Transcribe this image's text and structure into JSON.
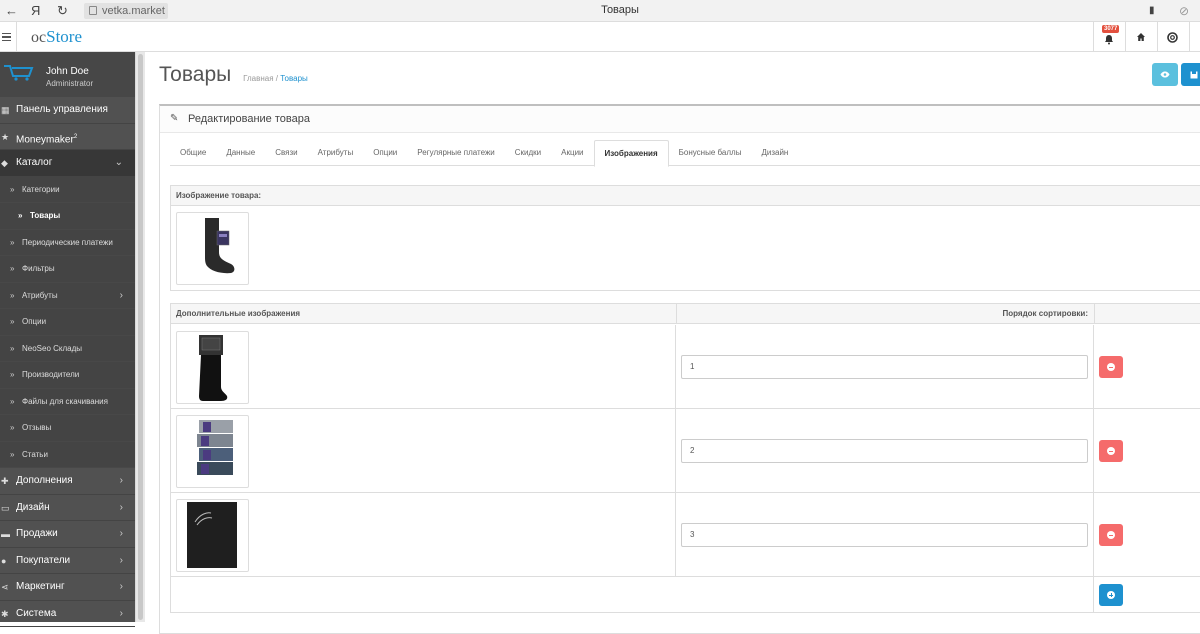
{
  "browser": {
    "address": "vetka.market",
    "title": "Товары",
    "yandex_glyph": "Я"
  },
  "header": {
    "logo_oc": "oc",
    "logo_store": "Store",
    "notification_count": "3077",
    "icons": [
      "bell-icon",
      "home-icon",
      "support-icon"
    ]
  },
  "sidebar": {
    "user_name": "John Doe",
    "user_role": "Administrator",
    "items": [
      {
        "label": "Панель управления",
        "icon": "dashboard-icon"
      },
      {
        "label": "Moneymaker",
        "sup": "2",
        "icon": "star-icon"
      },
      {
        "label": "Каталог",
        "icon": "tag-icon",
        "expanded": true
      }
    ],
    "catalog_sub": [
      {
        "label": "Категории"
      },
      {
        "label": "Товары",
        "current": true
      },
      {
        "label": "Периодические платежи"
      },
      {
        "label": "Фильтры"
      },
      {
        "label": "Атрибуты",
        "chevron": true
      },
      {
        "label": "Опции"
      },
      {
        "label": "NeoSeo Склады"
      },
      {
        "label": "Производители"
      },
      {
        "label": "Файлы для скачивания"
      },
      {
        "label": "Отзывы"
      },
      {
        "label": "Статьи"
      }
    ],
    "bottom_items": [
      {
        "label": "Дополнения",
        "icon": "puzzle-icon"
      },
      {
        "label": "Дизайн",
        "icon": "monitor-icon"
      },
      {
        "label": "Продажи",
        "icon": "cart-icon"
      },
      {
        "label": "Покупатели",
        "icon": "user-icon"
      },
      {
        "label": "Маркетинг",
        "icon": "share-icon"
      },
      {
        "label": "Система",
        "icon": "cog-icon"
      }
    ]
  },
  "page": {
    "title": "Товары",
    "breadcrumb_home": "Главная",
    "breadcrumb_sep": "/",
    "breadcrumb_current": "Товары",
    "panel_title": "Редактирование товара",
    "tabs": [
      "Общие",
      "Данные",
      "Связи",
      "Атрибуты",
      "Опции",
      "Регулярные платежи",
      "Скидки",
      "Акции",
      "Изображения",
      "Бонусные баллы",
      "Дизайн"
    ],
    "active_tab": "Изображения",
    "image_section_label": "Изображение товара:",
    "additional_label": "Дополнительные изображения",
    "sort_order_label": "Порядок сортировки:",
    "additional_images": [
      {
        "sort_order": "1",
        "thumb": "black-sock-packaged"
      },
      {
        "sort_order": "2",
        "thumb": "grey-blue-socks-stack"
      },
      {
        "sort_order": "3",
        "thumb": "black-fabric-closeup"
      }
    ]
  },
  "colors": {
    "accent_blue": "#1e91cf",
    "preview_button": "#5bc0de",
    "danger": "#f56b6b",
    "sidebar_bg": "#515151"
  }
}
